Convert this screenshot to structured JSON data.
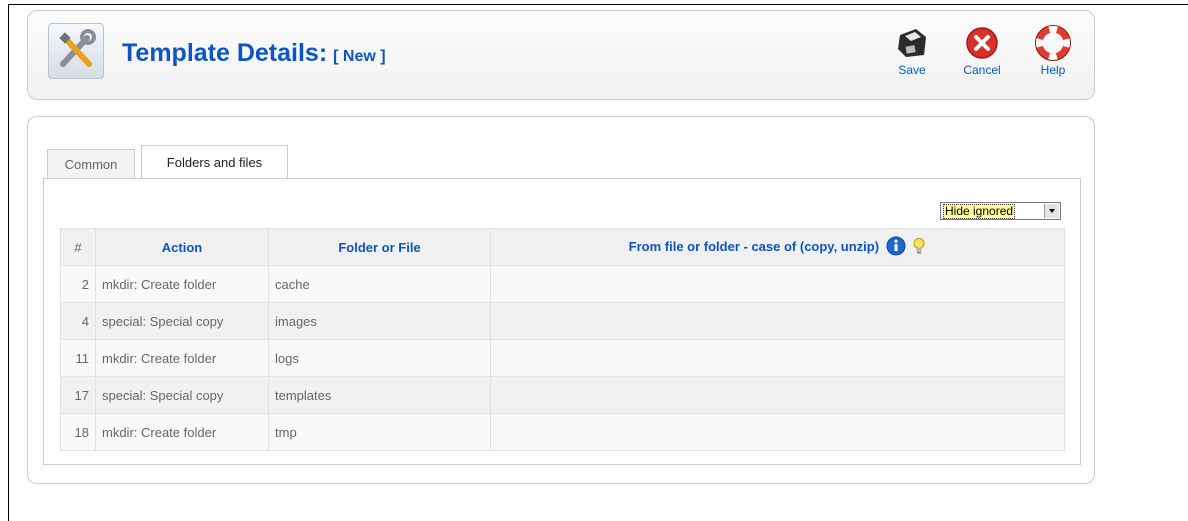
{
  "header": {
    "title": "Template Details:",
    "subtitle": "[ New ]"
  },
  "toolbar": {
    "save_label": "Save",
    "cancel_label": "Cancel",
    "help_label": "Help"
  },
  "tabs": [
    {
      "label": "Common"
    },
    {
      "label": "Folders and files"
    }
  ],
  "filter": {
    "selected": "Hide ignored"
  },
  "table": {
    "columns": [
      "#",
      "Action",
      "Folder or File",
      "From file or folder - case of (copy, unzip)"
    ],
    "rows": [
      {
        "num": "2",
        "action": "mkdir:  Create folder",
        "file": "cache",
        "from": ""
      },
      {
        "num": "4",
        "action": "special: Special copy",
        "file": "images",
        "from": ""
      },
      {
        "num": "11",
        "action": "mkdir:  Create folder",
        "file": "logs",
        "from": ""
      },
      {
        "num": "17",
        "action": "special: Special copy",
        "file": "templates",
        "from": ""
      },
      {
        "num": "18",
        "action": "mkdir:  Create folder",
        "file": "tmp",
        "from": ""
      }
    ]
  },
  "colors": {
    "title_blue": "#0b55c4",
    "cancel_red": "#d9302a",
    "help_red": "#e03b2f"
  },
  "icons": {
    "title": "tools-icon",
    "save": "save-icon",
    "cancel": "cancel-icon",
    "help": "help-icon",
    "info": "info-icon",
    "hint": "lightbulb-icon"
  }
}
